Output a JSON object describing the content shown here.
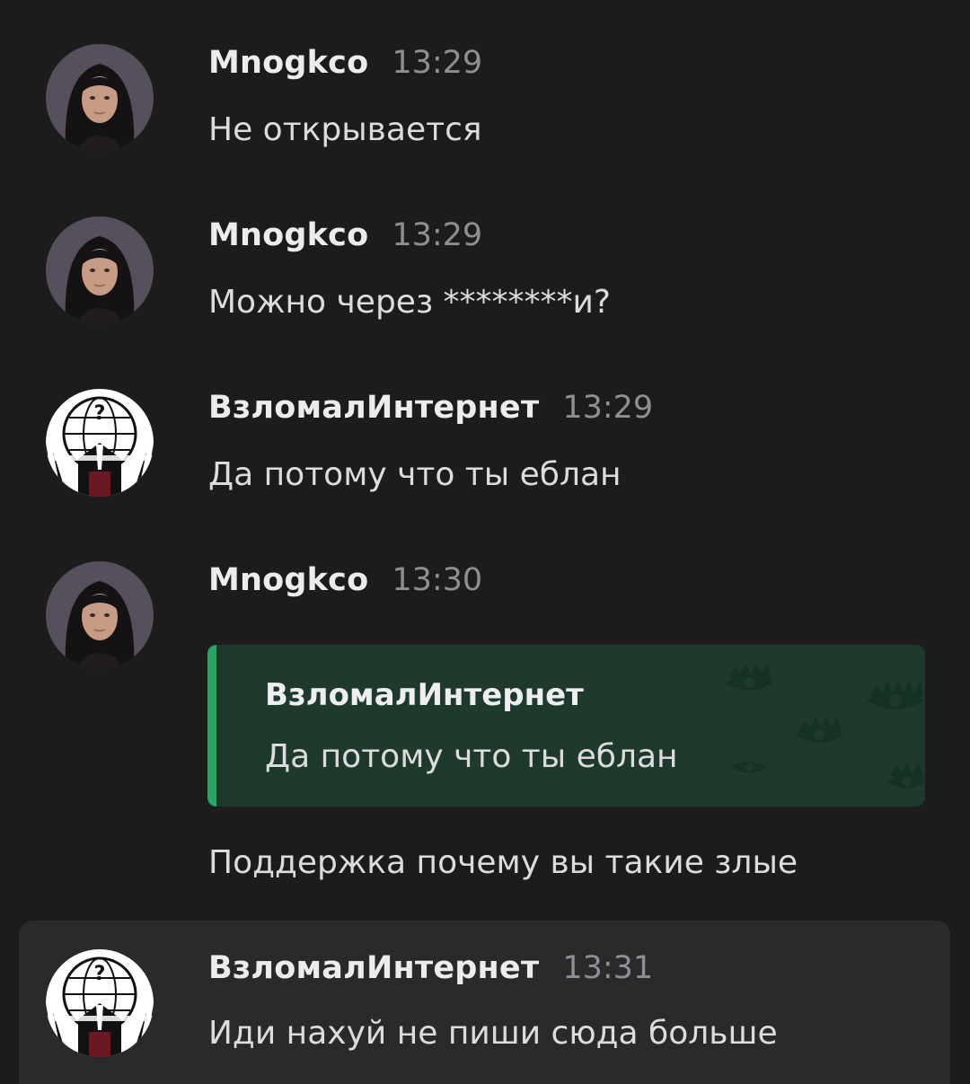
{
  "messages": [
    {
      "author": "Mnogkco",
      "time": "13:29",
      "text": "Не открывается"
    },
    {
      "author": "Mnogkco",
      "time": "13:29",
      "text": "Можно через ********и?"
    },
    {
      "author": "ВзломалИнтернет",
      "time": "13:29",
      "text": "Да потому что ты еблан"
    },
    {
      "author": "Mnogkco",
      "time": "13:30",
      "quote": {
        "author": "ВзломалИнтернет",
        "text": "Да потому что ты еблан"
      },
      "text": "Поддержка почему вы такие злые"
    },
    {
      "author": "ВзломалИнтернет",
      "time": "13:31",
      "text": "Иди нахуй не пиши сюда больше"
    }
  ],
  "colors": {
    "background": "#1c1c1d",
    "quote_background": "#1f3a2c",
    "quote_accent": "#2aa462",
    "highlight_background": "#2a2a2c",
    "timestamp": "#8e8e93"
  },
  "icons": {
    "user_avatar": "woman-portrait-avatar",
    "bot_avatar": "anonymous-globe-avatar"
  }
}
